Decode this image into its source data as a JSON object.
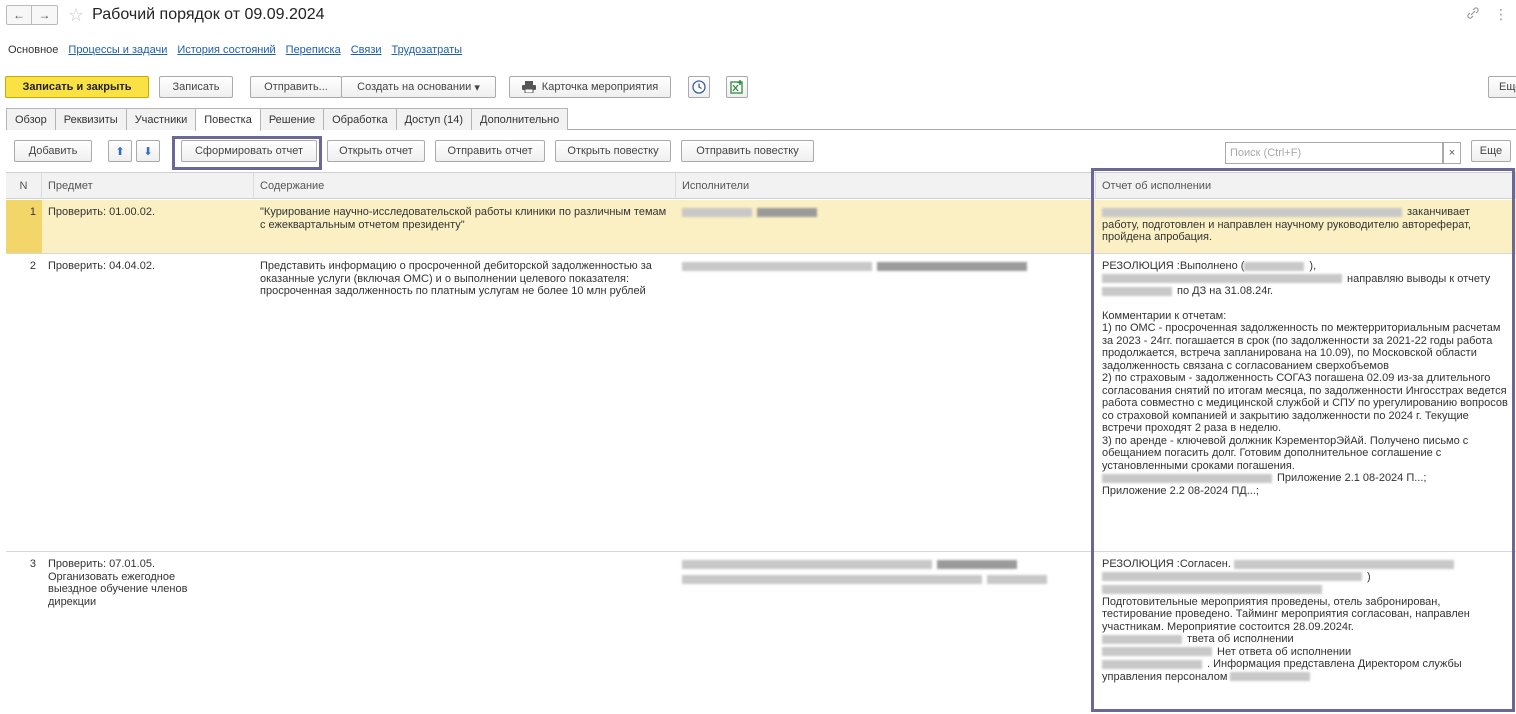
{
  "window": {
    "title": "Рабочий порядок от 09.09.2024",
    "back_glyph": "←",
    "forward_glyph": "→",
    "star_glyph": "☆",
    "link_glyph": "🔗",
    "more_glyph": "⋮"
  },
  "sections": [
    {
      "label": "Основное"
    },
    {
      "label": "Процессы и задачи"
    },
    {
      "label": "История состояний"
    },
    {
      "label": "Переписка"
    },
    {
      "label": "Связи"
    },
    {
      "label": "Трудозатраты"
    }
  ],
  "toolbar": {
    "save_close": "Записать и закрыть",
    "save": "Записать",
    "send": "Отправить...",
    "create_based": "Создать на основании",
    "create_based_arrow": "▾",
    "event_card": "Карточка мероприятия",
    "event_card_icon": "printer-icon",
    "more_label": "Еще"
  },
  "tabs": [
    {
      "label": "Обзор"
    },
    {
      "label": "Реквизиты"
    },
    {
      "label": "Участники"
    },
    {
      "label": "Повестка"
    },
    {
      "label": "Решение"
    },
    {
      "label": "Обработка"
    },
    {
      "label": "Доступ (14)"
    },
    {
      "label": "Дополнительно"
    }
  ],
  "table_toolbar": {
    "add": "Добавить",
    "up_glyph": "⬆",
    "down_glyph": "⬇",
    "form_report": "Сформировать отчет",
    "open_report": "Открыть отчет",
    "send_report": "Отправить отчет",
    "open_agenda": "Открыть повестку",
    "send_agenda": "Отправить повестку",
    "search_placeholder": "Поиск (Ctrl+F)",
    "search_clear": "×",
    "more": "Еще"
  },
  "table": {
    "columns": [
      "N",
      "Предмет",
      "Содержание",
      "Исполнители",
      "Отчет об исполнении"
    ],
    "rows": [
      {
        "n": "1",
        "subject": "Проверить: 01.00.02.",
        "content": "\"Курирование научно-исследовательской работы клиники по различным темам  с ежеквартальным отчетом президенту\"",
        "report_tail": "заканчивает",
        "report": "работу, подготовлен и направлен научному руководителю автореферат, пройдена апробация."
      },
      {
        "n": "2",
        "subject": "Проверить: 04.04.02.",
        "content": "Представить информацию о просроченной дебиторской задолженностью за оказанные услуги (включая ОМС) и о выполнении целевого показателя: просроченная задолженность по платным услугам не более 10 млн рублей",
        "report_line1": "РЕЗОЛЮЦИЯ :Выполнено (",
        "report_line1_tail": "),",
        "report_line2": "направляю выводы к отчету",
        "report_line3": "по ДЗ на 31.08.24г.",
        "report_body": "Комментарии к отчетам:\n1) по ОМС - просроченная задолженность по межтерриториальным расчетам за 2023 - 24гг. погашается в срок (по задолженности за 2021-22 годы работа продолжается, встреча запланирована на 10.09), по Московской области задолженность связана с согласованием сверхобъемов\n2) по страховым - задолженность СОГАЗ погашена 02.09 из-за длительного согласования снятий по итогам месяца, по задолженности Ингосстрах ведется работа совместно с медицинской службой и СПУ по урегулированию вопросов со страховой компанией и закрытию задолженности по 2024 г. Текущие встречи проходят 2 раза в неделю.\n3) по аренде - ключевой должник КэременторЭйАй. Получено письмо с обещанием погасить долг. Готовим дополнительное соглашение с установленными сроками погашения.",
        "report_att1": "Приложение 2.1 08-2024  П...;",
        "report_att2": "Приложение 2.2 08-2024 ПД...;"
      },
      {
        "n": "3",
        "subject": "Проверить: 07.01.05.\nОрганизовать ежегодное выездное обучение членов дирекции",
        "content": "",
        "report_line1": "РЕЗОЛЮЦИЯ :Согласен.",
        "report_line2_tail": ")",
        "report_body": "Подготовительные мероприятия проведены, отель забронирован, тестирование проведено. Тайминг мероприятия согласован, направлен участникам. Мероприятие состоится 28.09.2024г.",
        "report_l1": "тветa об исполнении",
        "report_l2": "Нет ответа об исполнении",
        "report_l3": ". Информация представлена Директором службы",
        "report_l4": "управления персоналом"
      }
    ]
  },
  "colors": {
    "accent": "#fbe244",
    "highlight": "#6a6897",
    "selected_row": "#fbf0c4",
    "link": "#1e5fa8"
  }
}
